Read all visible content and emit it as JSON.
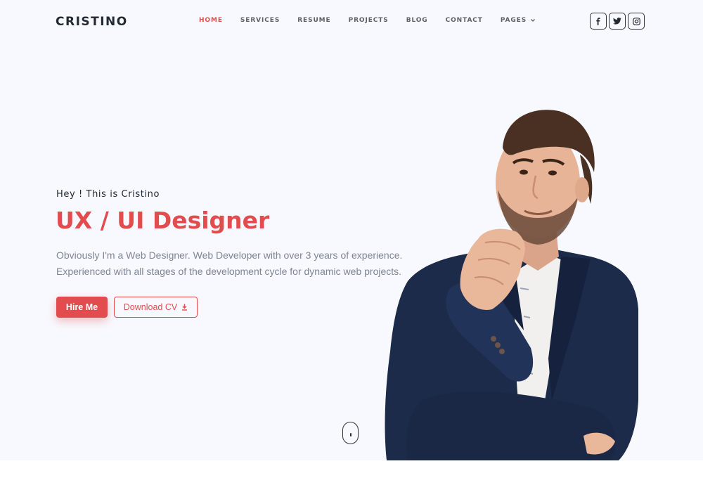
{
  "header": {
    "logo": "CRISTINO",
    "nav": [
      {
        "label": "HOME",
        "active": true
      },
      {
        "label": "SERVICES",
        "active": false
      },
      {
        "label": "RESUME",
        "active": false
      },
      {
        "label": "PROJECTS",
        "active": false
      },
      {
        "label": "BLOG",
        "active": false
      },
      {
        "label": "CONTACT",
        "active": false
      },
      {
        "label": "PAGES",
        "active": false,
        "dropdown": true
      }
    ],
    "socials": [
      {
        "icon": "facebook-icon",
        "glyph": "f"
      },
      {
        "icon": "twitter-icon"
      },
      {
        "icon": "instagram-icon"
      }
    ]
  },
  "hero": {
    "greeting": "Hey ! This is Cristino",
    "headline": "UX / UI Designer",
    "description_lines": [
      "Obviously I'm a Web Designer. Web Developer with over 3 years of experience.",
      "Experienced with all stages of the development cycle for dynamic web projects."
    ],
    "primary_button": "Hire Me",
    "secondary_button": "Download CV"
  },
  "colors": {
    "accent": "#e34c4f",
    "hero_bg": "#f8f9fe",
    "dark": "#232a34",
    "muted": "#7d8594"
  }
}
